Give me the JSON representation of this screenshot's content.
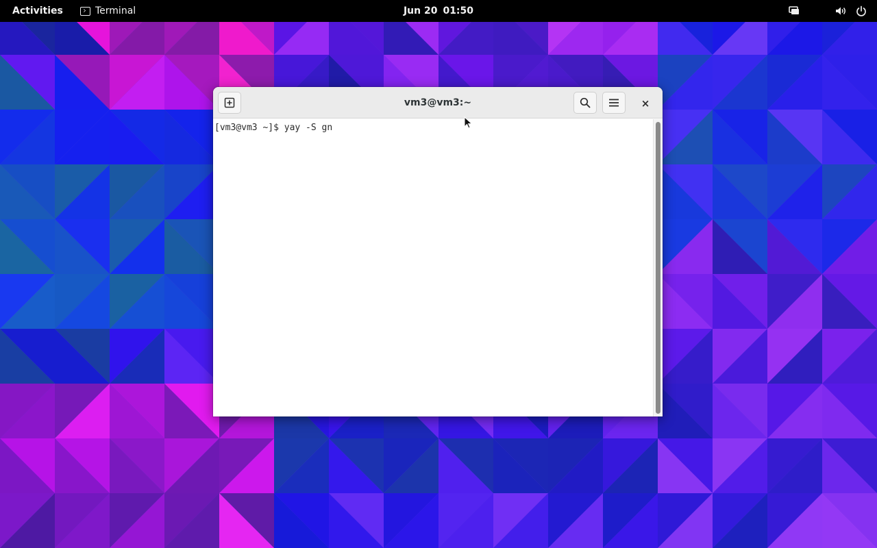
{
  "topbar": {
    "activities_label": "Activities",
    "app_name": "Terminal",
    "date": "Jun 20",
    "time": "01:50"
  },
  "window": {
    "title": "vm3@vm3:~",
    "close_glyph": "×"
  },
  "terminal": {
    "prompt": "[vm3@vm3 ~]$",
    "command": "yay -S gn"
  },
  "icons": {
    "app_menu": "terminal-icon",
    "new_tab": "new-tab-icon",
    "search": "search-icon",
    "menu": "hamburger-menu-icon",
    "close": "close-icon",
    "tray_display": "display-icon",
    "tray_volume": "volume-icon",
    "tray_power": "power-icon"
  },
  "colors": {
    "topbar_bg": "#000000",
    "headerbar_bg": "#ebebeb",
    "wallpaper_base": "#5a3fd8"
  }
}
